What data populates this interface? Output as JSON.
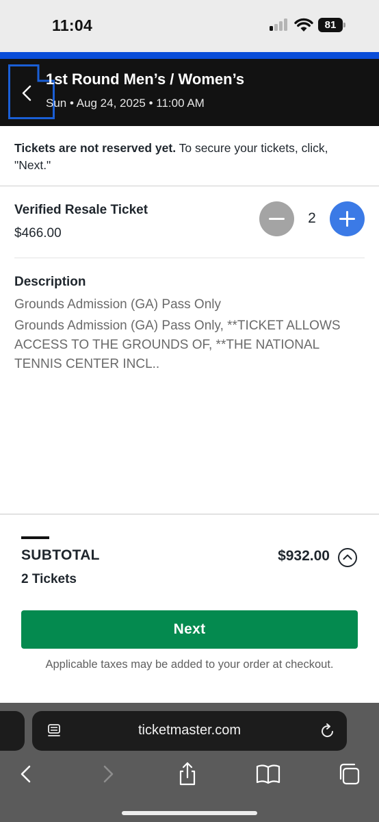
{
  "status_bar": {
    "time": "11:04",
    "battery_level": "81",
    "signal_bars_active": 1,
    "signal_bars_total": 4
  },
  "header": {
    "title": "1st Round Men’s / Women’s",
    "date": "Sun • Aug 24, 2025 • 11:00 AM",
    "back_icon": "chevron-left-icon",
    "brand_color": "#0a4dd8"
  },
  "notice": {
    "bold_text": "Tickets are not reserved yet.",
    "text": " To secure your tickets, click, \"Next.\""
  },
  "ticket": {
    "name": "Verified Resale Ticket",
    "price": "$466.00",
    "quantity": "2",
    "minus_icon": "minus-circle-icon",
    "plus_icon": "plus-circle-icon"
  },
  "description": {
    "heading": "Description",
    "line1": "Grounds Admission (GA) Pass Only",
    "line2": "Grounds Admission (GA) Pass Only, **TICKET ALLOWS ACCESS TO THE GROUNDS OF, **THE NATIONAL TENNIS CENTER INCL.."
  },
  "footer": {
    "subtotal_label": "SUBTOTAL",
    "subtotal_amount": "$932.00",
    "ticket_count": "2 Tickets",
    "next_label": "Next",
    "tax_note": "Applicable taxes may be added to your order at checkout.",
    "expand_icon": "chevron-up-circle-icon",
    "next_color": "#048a4f"
  },
  "browser": {
    "url": "ticketmaster.com",
    "icons": [
      "reader-icon",
      "reload-icon",
      "back-arrow-icon",
      "forward-arrow-icon",
      "share-icon",
      "bookmarks-icon",
      "tabs-icon"
    ]
  }
}
